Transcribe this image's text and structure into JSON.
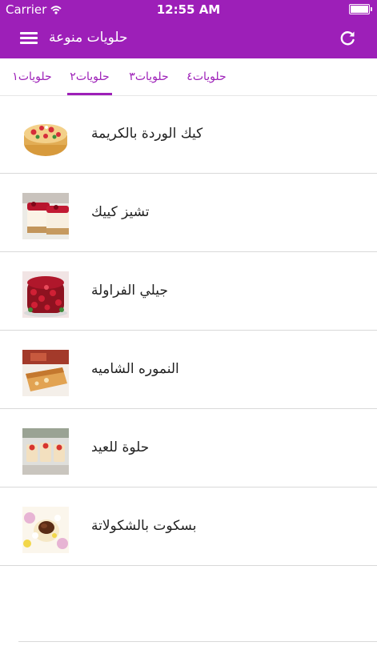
{
  "status": {
    "carrier": "Carrier",
    "time": "12:55 AM"
  },
  "header": {
    "title": "حلويات منوعة"
  },
  "tabs": [
    {
      "label": "حلويات١"
    },
    {
      "label": "حلويات٢"
    },
    {
      "label": "حلويات٣"
    },
    {
      "label": "حلويات٤"
    }
  ],
  "items": [
    {
      "label": "كيك الوردة بالكريمة"
    },
    {
      "label": "تشيز كييك"
    },
    {
      "label": "جيلي الفراولة"
    },
    {
      "label": "النموره الشاميه"
    },
    {
      "label": "حلوة للعيد"
    },
    {
      "label": "بسكوت بالشكولاتة"
    }
  ],
  "colors": {
    "accent": "#9d1fb8"
  }
}
